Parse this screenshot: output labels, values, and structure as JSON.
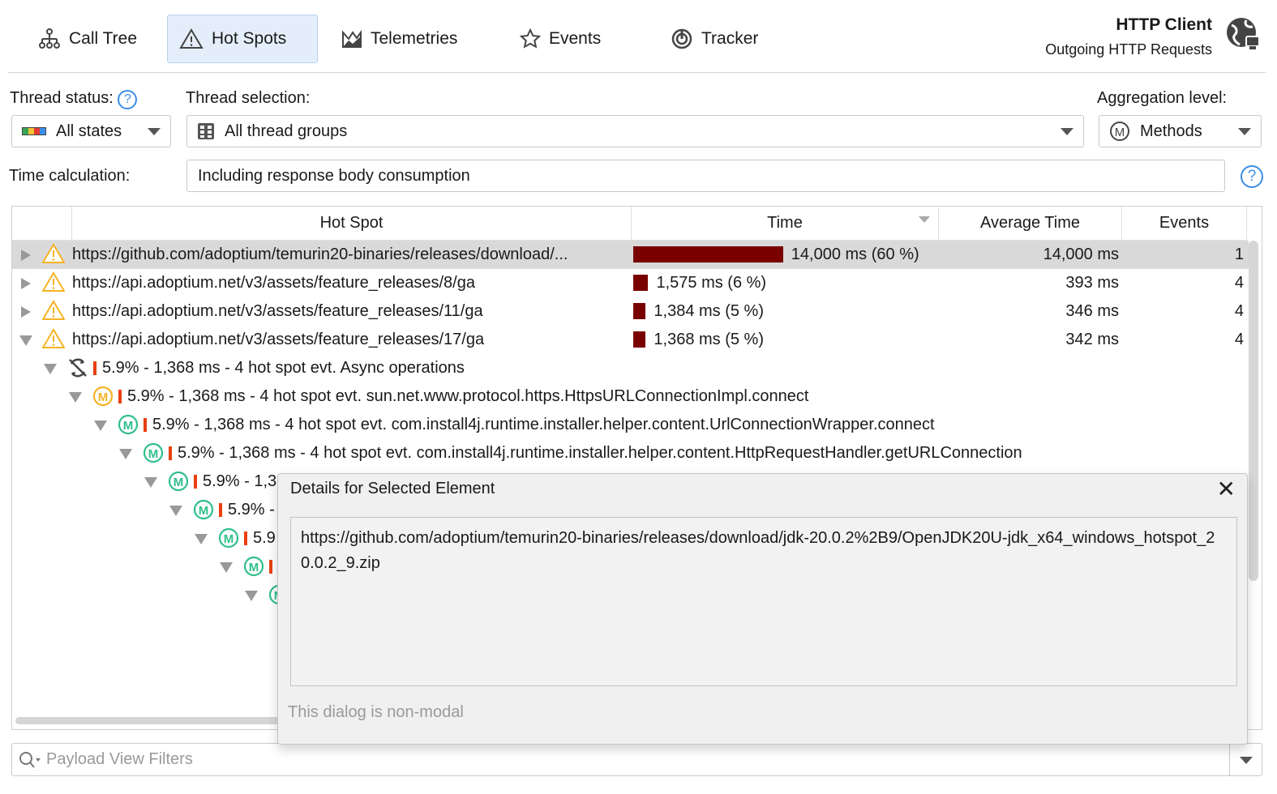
{
  "tabs": [
    {
      "label": "Call Tree",
      "icon": "call-tree-icon"
    },
    {
      "label": "Hot Spots",
      "icon": "warning-icon",
      "selected": true
    },
    {
      "label": "Telemetries",
      "icon": "telemetries-icon"
    },
    {
      "label": "Events",
      "icon": "star-icon"
    },
    {
      "label": "Tracker",
      "icon": "tracker-icon"
    }
  ],
  "header": {
    "title": "HTTP Client",
    "subtitle": "Outgoing HTTP Requests"
  },
  "controls": {
    "thread_status_label": "Thread status:",
    "thread_status_value": "All states",
    "thread_selection_label": "Thread selection:",
    "thread_selection_value": "All thread groups",
    "aggregation_label": "Aggregation level:",
    "aggregation_value": "Methods",
    "time_calc_label": "Time calculation:",
    "time_calc_value": "Including response body consumption",
    "help": "?"
  },
  "table": {
    "columns": [
      "Hot Spot",
      "Time",
      "Average Time",
      "Events"
    ],
    "rows": [
      {
        "hotspot": "https://github.com/adoptium/temurin20-binaries/releases/download/...",
        "time": "14,000 ms (60 %)",
        "percent": 60,
        "avg": "14,000 ms",
        "events": "1"
      },
      {
        "hotspot": "https://api.adoptium.net/v3/assets/feature_releases/8/ga",
        "time": "1,575 ms (6 %)",
        "percent": 6,
        "avg": "393 ms",
        "events": "4"
      },
      {
        "hotspot": "https://api.adoptium.net/v3/assets/feature_releases/11/ga",
        "time": "1,384 ms (5 %)",
        "percent": 5,
        "avg": "346 ms",
        "events": "4"
      },
      {
        "hotspot": "https://api.adoptium.net/v3/assets/feature_releases/17/ga",
        "time": "1,368 ms (5 %)",
        "percent": 5,
        "avg": "342 ms",
        "events": "4"
      }
    ],
    "tree": [
      "5.9% - 1,368 ms - 4 hot spot evt. Async operations",
      "5.9% - 1,368 ms - 4 hot spot evt. sun.net.www.protocol.https.HttpsURLConnectionImpl.connect",
      "5.9% - 1,368 ms - 4 hot spot evt. com.install4j.runtime.installer.helper.content.UrlConnectionWrapper.connect",
      "5.9% - 1,368 ms - 4 hot spot evt. com.install4j.runtime.installer.helper.content.HttpRequestHandler.getURLConnection",
      "5.9% - 1,3",
      "5.9% -",
      "5.9"
    ]
  },
  "dialog": {
    "title": "Details for Selected Element",
    "content": "https://github.com/adoptium/temurin20-binaries/releases/download/jdk-20.0.2%2B9/OpenJDK20U-jdk_x64_windows_hotspot_20.0.2_9.zip",
    "footer": "This dialog is non-modal"
  },
  "filter": {
    "placeholder": "Payload View Filters"
  },
  "colors": {
    "bar": "#7a0000",
    "tab_selected": "#e4eefa",
    "method_green": "#2fbf8a",
    "method_orange": "#f5b324",
    "warning": "#f5b324"
  }
}
